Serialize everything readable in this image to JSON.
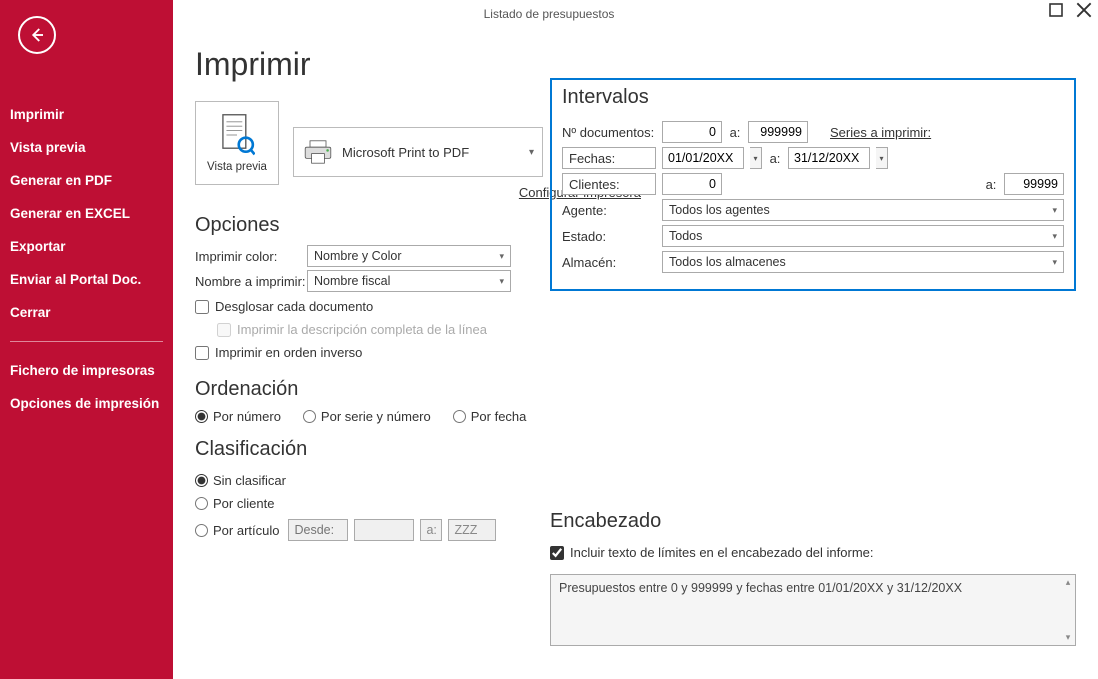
{
  "window": {
    "title": "Listado de presupuestos"
  },
  "sidebar": {
    "items": [
      "Imprimir",
      "Vista previa",
      "Generar en PDF",
      "Generar en EXCEL",
      "Exportar",
      "Enviar al Portal Doc.",
      "Cerrar"
    ],
    "items2": [
      "Fichero de impresoras",
      "Opciones de impresión"
    ]
  },
  "page_title": "Imprimir",
  "preview": {
    "label": "Vista previa"
  },
  "printer": {
    "name": "Microsoft Print to PDF",
    "config_link": "Configurar impresora"
  },
  "opciones": {
    "title": "Opciones",
    "imprimir_color_label": "Imprimir color:",
    "imprimir_color_value": "Nombre y Color",
    "nombre_label": "Nombre a imprimir:",
    "nombre_value": "Nombre fiscal",
    "chk_desglosar": "Desglosar cada documento",
    "chk_desc_linea": "Imprimir la descripción completa de la línea",
    "chk_orden_inverso": "Imprimir en orden inverso"
  },
  "ordenacion": {
    "title": "Ordenación",
    "por_numero": "Por número",
    "por_serie": "Por serie y número",
    "por_fecha": "Por fecha"
  },
  "clasificacion": {
    "title": "Clasificación",
    "sin_clasificar": "Sin clasificar",
    "por_cliente": "Por cliente",
    "por_articulo": "Por artículo",
    "desde": "Desde:",
    "a": "a:",
    "a_value": "ZZZ"
  },
  "intervalos": {
    "title": "Intervalos",
    "ndoc_label": "Nº documentos:",
    "ndoc_from": "0",
    "a": "a:",
    "ndoc_to": "999999",
    "series_link": "Series a imprimir:",
    "fechas_btn": "Fechas:",
    "fecha_from": "01/01/20XX",
    "fecha_to": "31/12/20XX",
    "clientes_btn": "Clientes:",
    "clientes_from": "0",
    "clientes_to": "99999",
    "agente_label": "Agente:",
    "agente_value": "Todos los agentes",
    "estado_label": "Estado:",
    "estado_value": "Todos",
    "almacen_label": "Almacén:",
    "almacen_value": "Todos los almacenes"
  },
  "encabezado": {
    "title": "Encabezado",
    "chk": "Incluir texto de límites en el encabezado del informe:",
    "text": "Presupuestos entre 0 y 999999 y fechas entre 01/01/20XX y 31/12/20XX"
  }
}
